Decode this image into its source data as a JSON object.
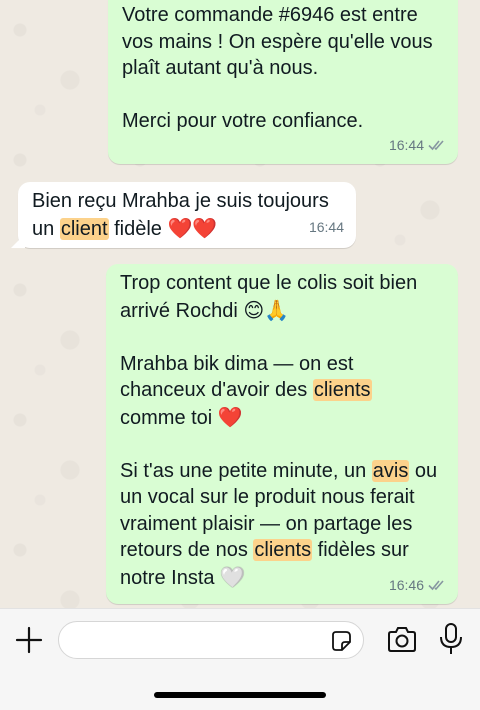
{
  "messages": [
    {
      "id": "m1",
      "direction": "outgoing",
      "lines": [
        "Votre commande #6946 est entre",
        "vos mains ! On espère qu'elle vous",
        "plaît autant qu'à nous."
      ],
      "lines2": [
        "Merci pour votre confiance."
      ],
      "time": "16:44",
      "status": "read"
    },
    {
      "id": "m2",
      "direction": "incoming",
      "line1": "Bien reçu Mrahba je suis toujours",
      "line2_pre": "un ",
      "line2_hl": "client",
      "line2_post": " fidèle ",
      "hearts": "❤️❤️",
      "time": "16:44"
    },
    {
      "id": "m3",
      "direction": "outgoing",
      "p1_line1": "Trop content que le colis soit bien",
      "p1_line2": "arrivé Rochdi ",
      "p1_emoji": "😊🙏",
      "p2_line1": "Mrahba bik dima — on est",
      "p2_line2_pre": "chanceux d'avoir des ",
      "p2_line2_hl": "clients",
      "p2_line3": "comme toi ",
      "p2_heart": "❤️",
      "p3_line1_pre": "Si t'as une petite minute, un ",
      "p3_line1_hl": "avis",
      "p3_line1_post": " ou",
      "p3_line2": "un vocal sur le produit nous ferait",
      "p3_line3": "vraiment plaisir — on partage les",
      "p3_line4_pre": "retours de nos ",
      "p3_line4_hl": "clients",
      "p3_line4_post": " fidèles sur",
      "p3_line5": "notre Insta ",
      "p3_heart": "🤍",
      "time": "16:46",
      "status": "read"
    }
  ],
  "composer": {
    "placeholder": ""
  },
  "icons": {
    "attach": "plus-icon",
    "sticker": "sticker-icon",
    "camera": "camera-icon",
    "mic": "microphone-icon",
    "read": "double-check-icon"
  },
  "colors": {
    "outgoing_bubble": "#d9fdd3",
    "incoming_bubble": "#ffffff",
    "highlight": "#fcd28b",
    "chat_background": "#efeae2"
  }
}
